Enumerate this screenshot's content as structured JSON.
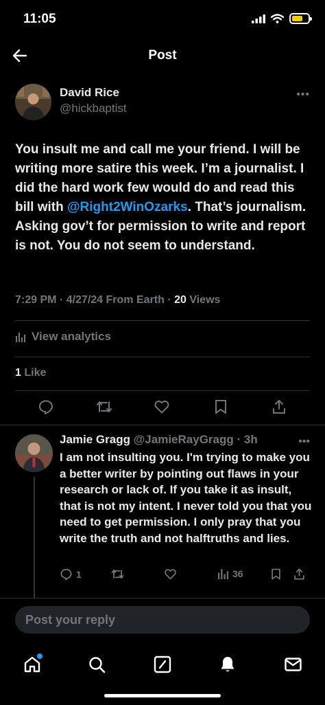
{
  "status_bar": {
    "time": "11:05"
  },
  "header": {
    "title": "Post"
  },
  "post": {
    "author_name": "David Rice",
    "author_handle": "@hickbaptist",
    "text_before": "You insult me and call me your friend. I will be writing more satire this week. I’m a journalist. I did the hard work few would do and read this bill with ",
    "mention": "@Right2WinOzarks",
    "text_after": ". That’s journalism. Asking gov’t for permission to write and report is not. You do not seem to understand.",
    "time": "7:29 PM",
    "date": "4/27/24",
    "source": "From Earth",
    "views_count": "20",
    "views_label": "Views",
    "analytics_label": "View analytics",
    "likes_count": "1",
    "likes_label": "Like"
  },
  "reply": {
    "author_name": "Jamie Gragg",
    "author_handle": "@JamieRayGragg",
    "age": "3h",
    "text": "I am not insulting you. I'm trying to make you a better writer by pointing out flaws in your research or lack of. If you take it as insult, that is not my intent. I never told you that you need to get permission. I only pray that you write the truth and not halftruths and lies.",
    "replies_count": "1",
    "views_count": "36"
  },
  "reply_bar": {
    "placeholder": "Post your reply"
  },
  "tabs": [
    "home",
    "search",
    "grok",
    "notifications",
    "messages"
  ],
  "colors": {
    "accent": "#1d9bf0",
    "muted": "#71767b",
    "text": "#e7e9ea",
    "background": "#000000"
  }
}
